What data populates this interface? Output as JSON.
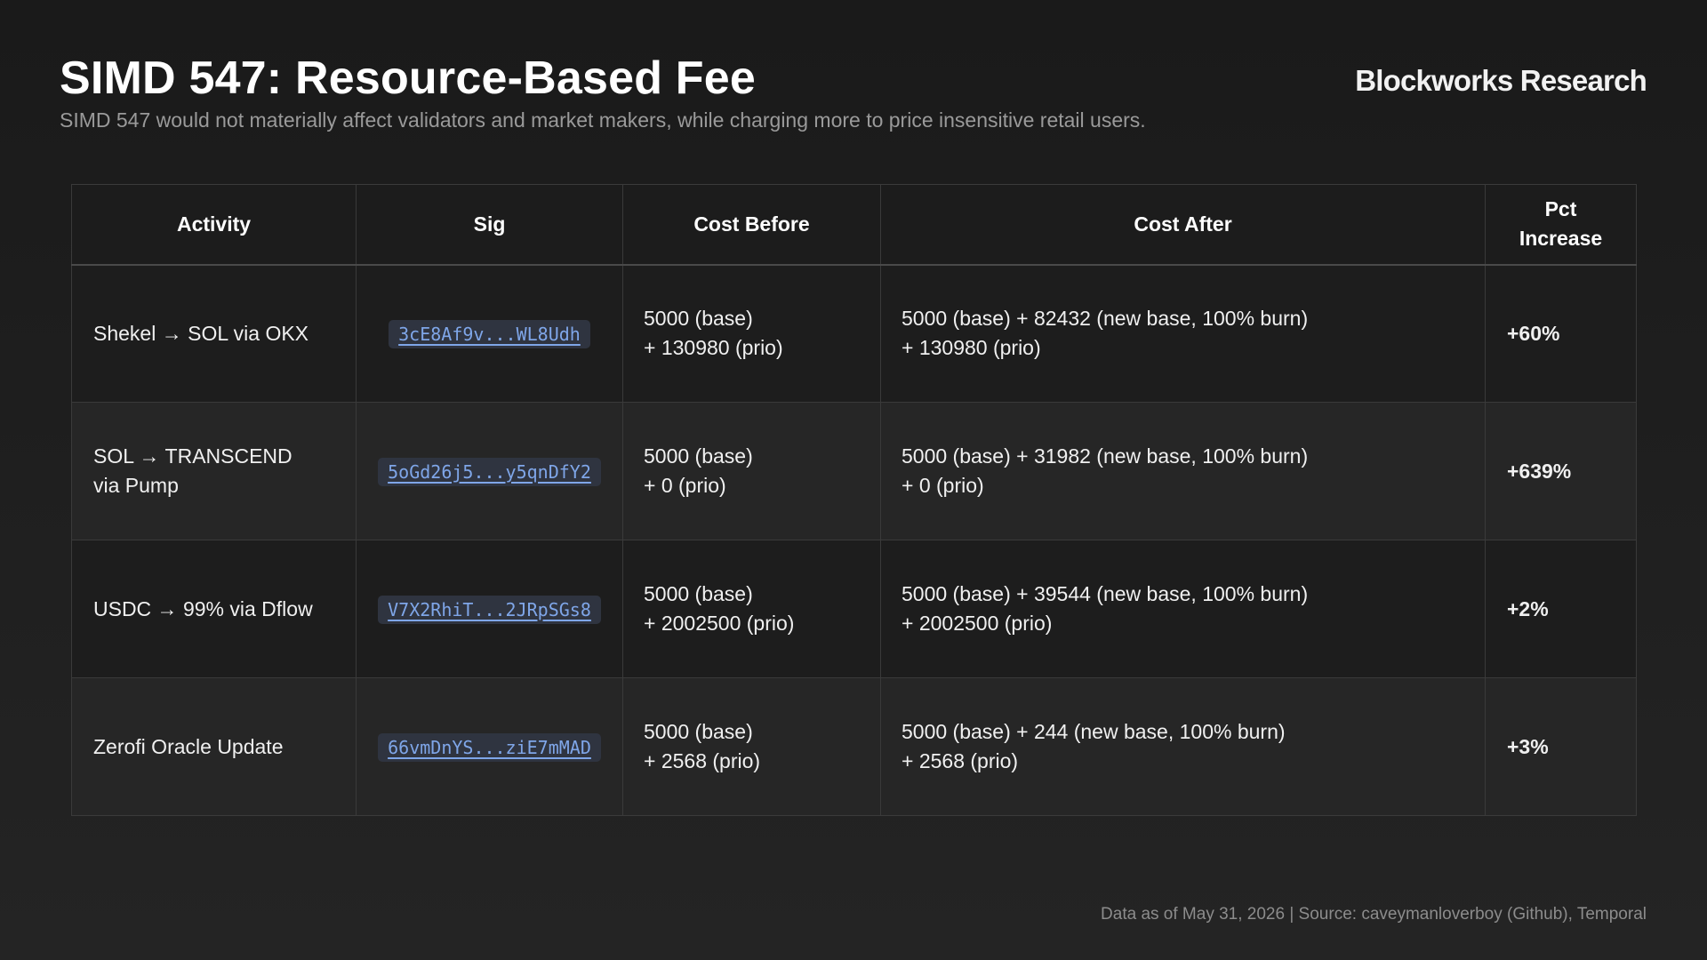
{
  "header": {
    "title": "SIMD 547: Resource-Based Fee",
    "subtitle": "SIMD 547 would not materially affect validators and market makers, while charging more to price insensitive retail users.",
    "brand": "Blockworks Research"
  },
  "table": {
    "columns": [
      "Activity",
      "Sig",
      "Cost Before",
      "Cost After",
      "Pct Increase"
    ],
    "rows": [
      {
        "activity": "Shekel → SOL via OKX",
        "sig": "3cE8Af9v...WL8Udh",
        "cost_before": [
          "5000 (base)",
          "+ 130980 (prio)"
        ],
        "cost_after": [
          "5000 (base) + 82432 (new base, 100% burn)",
          "+ 130980 (prio)"
        ],
        "pct": "+60%"
      },
      {
        "activity": "SOL → TRANSCEND via Pump",
        "sig": "5oGd26j5...y5qnDfY2",
        "cost_before": [
          "5000 (base)",
          "+ 0 (prio)"
        ],
        "cost_after": [
          "5000 (base) + 31982 (new base, 100% burn)",
          "+ 0 (prio)"
        ],
        "pct": "+639%"
      },
      {
        "activity": "USDC → 99% via Dflow",
        "sig": "V7X2RhiT...2JRpSGs8",
        "cost_before": [
          "5000 (base)",
          "+ 2002500 (prio)"
        ],
        "cost_after": [
          "5000 (base) + 39544 (new base, 100% burn)",
          "+ 2002500 (prio)"
        ],
        "pct": "+2%"
      },
      {
        "activity": "Zerofi Oracle Update",
        "sig": "66vmDnYS...ziE7mMAD",
        "cost_before": [
          "5000 (base)",
          "+ 2568 (prio)"
        ],
        "cost_after": [
          "5000 (base) + 244 (new base, 100% burn)",
          "+ 2568 (prio)"
        ],
        "pct": "+3%"
      }
    ]
  },
  "footer": {
    "source": "Data as of May 31, 2026 | Source: caveymanloverboy (Github), Temporal"
  },
  "colors": {
    "background": "#1e1e1e",
    "sig_link": "#7fa6e8",
    "sig_badge_bg": "#2f3440",
    "subtitle_text": "#9a9a9a"
  }
}
